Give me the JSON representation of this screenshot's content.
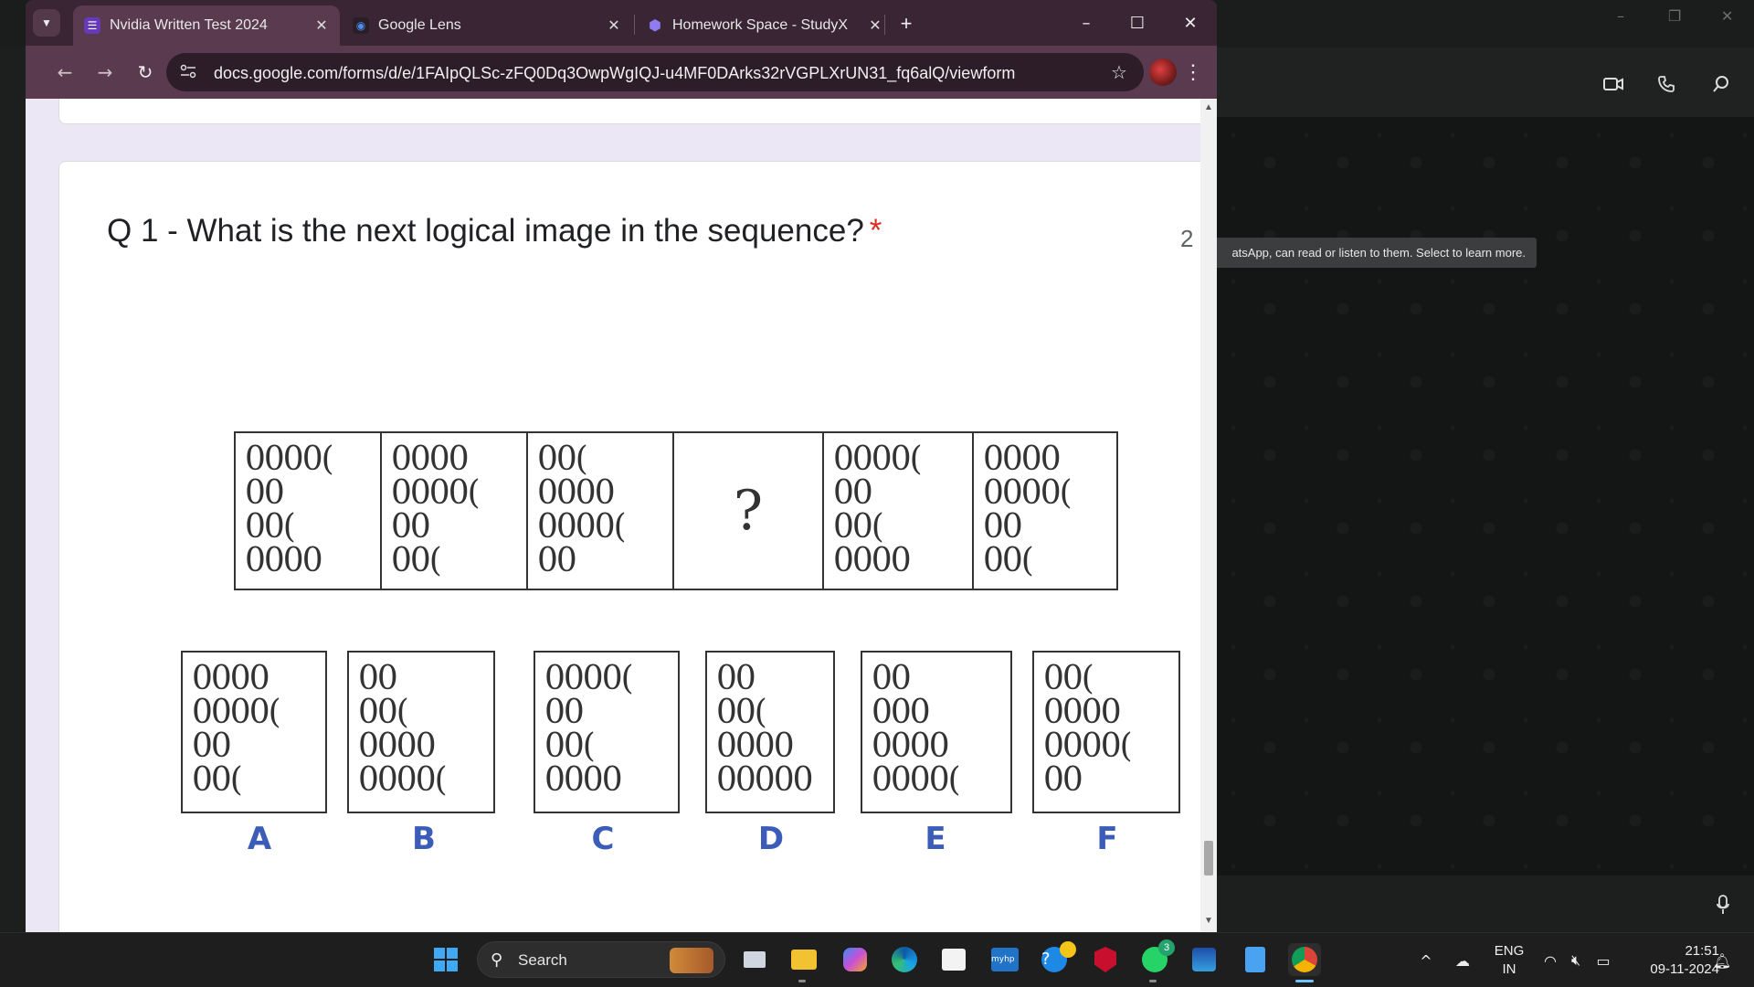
{
  "browser": {
    "tabs": [
      {
        "title": "Nvidia Written Test 2024",
        "favicon": "google-forms-icon",
        "active": true
      },
      {
        "title": "Google Lens",
        "favicon": "google-lens-icon",
        "active": false
      },
      {
        "title": "Homework Space - StudyX",
        "favicon": "studyx-icon",
        "active": false
      }
    ],
    "url": "docs.google.com/forms/d/e/1FAIpQLSc-zFQ0Dq3OwpWgIQJ-u4MF0DArks32rVGPLXrUN31_fq6alQ/viewform"
  },
  "form": {
    "question_title": "Q 1 -  What is the next logical image in the sequence?",
    "required_mark": "*",
    "points": "2",
    "sequence": [
      "0000(\n00\n00(\n0000",
      "0000\n0000(\n00\n00(",
      "00(\n0000\n0000(\n00",
      "?",
      "0000(\n00\n00(\n0000",
      "0000\n0000(\n00\n00("
    ],
    "options": [
      {
        "label": "A",
        "text": "0000\n0000(\n00\n00("
      },
      {
        "label": "B",
        "text": "00\n00(\n0000\n0000("
      },
      {
        "label": "C",
        "text": "0000(\n00\n00(\n0000"
      },
      {
        "label": "D",
        "text": "00\n00(\n0000\n00000"
      },
      {
        "label": "E",
        "text": "00\n000\n0000\n0000("
      },
      {
        "label": "F",
        "text": "00(\n0000\n0000(\n00"
      }
    ]
  },
  "whatsapp": {
    "tooltip": "atsApp, can read or listen to them. Select to learn more."
  },
  "taskbar": {
    "search_placeholder": "Search",
    "language": "ENG",
    "region": "IN",
    "time": "21:51",
    "date": "09-11-2024",
    "whatsapp_badge": "3"
  },
  "colors": {
    "chrome_frame": "#3a2534",
    "chrome_toolbar": "#5a3a4e",
    "form_bg": "#ece7f5",
    "required": "#d93025",
    "option_label": "#3b5db8"
  }
}
